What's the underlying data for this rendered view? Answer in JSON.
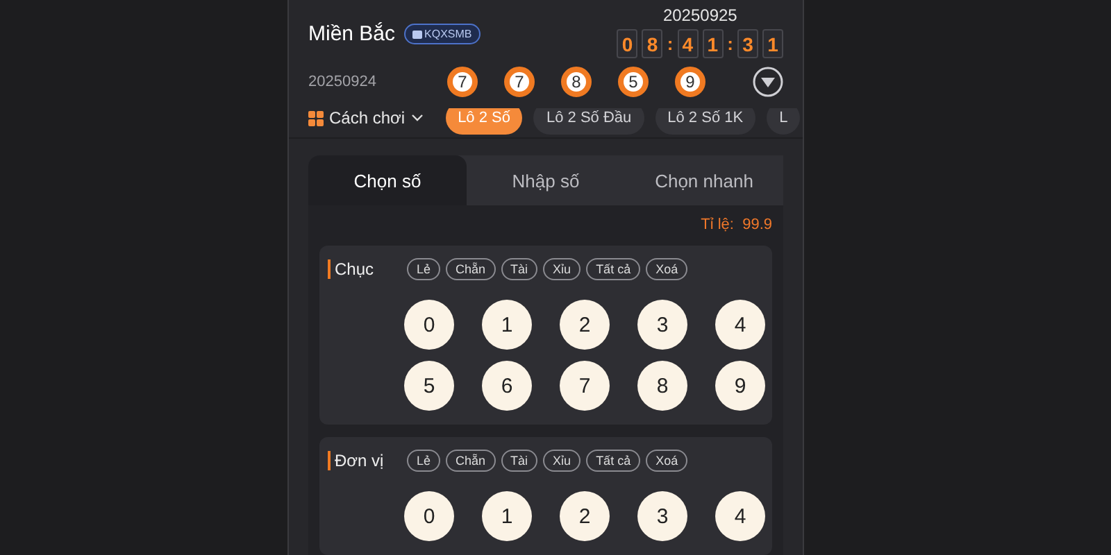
{
  "region": {
    "title": "Miền Bắc",
    "badge": "KQXSMB"
  },
  "next_draw": {
    "date": "20250925",
    "countdown": [
      {
        "text": "0",
        "kind": "digit"
      },
      {
        "text": "8",
        "kind": "digit"
      },
      {
        "text": ":",
        "kind": "sep"
      },
      {
        "text": "4",
        "kind": "digit"
      },
      {
        "text": "1",
        "kind": "digit"
      },
      {
        "text": ":",
        "kind": "sep"
      },
      {
        "text": "3",
        "kind": "digit"
      },
      {
        "text": "1",
        "kind": "digit"
      }
    ]
  },
  "last_draw": {
    "date": "20250924",
    "results": [
      "7",
      "7",
      "8",
      "5",
      "9"
    ]
  },
  "play_menu": {
    "label": "Cách chơi"
  },
  "play_types": [
    {
      "label": "Lô 2 Số",
      "selected": true
    },
    {
      "label": "Lô 2 Số Đầu",
      "selected": false
    },
    {
      "label": "Lô 2 Số 1K",
      "selected": false
    },
    {
      "label": "L",
      "selected": false
    }
  ],
  "mode_tabs": [
    {
      "label": "Chọn số",
      "selected": true
    },
    {
      "label": "Nhập số",
      "selected": false
    },
    {
      "label": "Chọn nhanh",
      "selected": false
    }
  ],
  "odds": {
    "label": "Tỉ lệ:",
    "value": "99.9"
  },
  "sections": [
    {
      "title": "Chục",
      "filters": [
        "Lẻ",
        "Chẵn",
        "Tài",
        "Xỉu",
        "Tất cả",
        "Xoá"
      ],
      "numbers": [
        {
          "label": "0",
          "selected": false
        },
        {
          "label": "1",
          "selected": false
        },
        {
          "label": "2",
          "selected": false
        },
        {
          "label": "3",
          "selected": false
        },
        {
          "label": "4",
          "selected": false
        },
        {
          "label": "5",
          "selected": false
        },
        {
          "label": "6",
          "selected": false
        },
        {
          "label": "7",
          "selected": false
        },
        {
          "label": "8",
          "selected": false
        },
        {
          "label": "9",
          "selected": false
        }
      ]
    },
    {
      "title": "Đơn vị",
      "filters": [
        "Lẻ",
        "Chẵn",
        "Tài",
        "Xỉu",
        "Tất cả",
        "Xoá"
      ],
      "numbers": [
        {
          "label": "0",
          "selected": false
        },
        {
          "label": "1",
          "selected": false
        },
        {
          "label": "2",
          "selected": false
        },
        {
          "label": "3",
          "selected": false
        },
        {
          "label": "4",
          "selected": false
        }
      ]
    }
  ]
}
